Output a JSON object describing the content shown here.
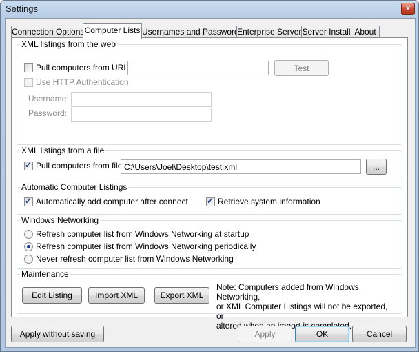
{
  "window": {
    "title": "Settings",
    "close_glyph": "x"
  },
  "tabs": [
    {
      "label": "Connection Options",
      "active": false
    },
    {
      "label": "Computer Lists",
      "active": true
    },
    {
      "label": "Usernames and Passwords",
      "active": false
    },
    {
      "label": "Enterprise Server",
      "active": false
    },
    {
      "label": "Server Install",
      "active": false
    },
    {
      "label": "About",
      "active": false
    }
  ],
  "web_group": {
    "title": "XML listings from the web",
    "pull_url_label": "Pull computers from URL:",
    "pull_url_checked": false,
    "url_value": "",
    "test_button": "Test",
    "http_auth_label": "Use HTTP Authentication",
    "http_auth_checked": false,
    "username_label": "Username:",
    "username_value": "",
    "password_label": "Password:",
    "password_value": ""
  },
  "file_group": {
    "title": "XML listings from a file",
    "pull_file_label": "Pull computers from file:",
    "pull_file_checked": true,
    "file_path": "C:\\Users\\Joel\\Desktop\\test.xml",
    "browse_button": "..."
  },
  "auto_group": {
    "title": "Automatic Computer Listings",
    "auto_add_label": "Automatically add computer after connect",
    "auto_add_checked": true,
    "retrieve_label": "Retrieve system information",
    "retrieve_checked": true
  },
  "networking_group": {
    "title": "Windows Networking",
    "options": [
      {
        "label": "Refresh computer list from Windows Networking at startup",
        "selected": false
      },
      {
        "label": "Refresh computer list from Windows Networking periodically",
        "selected": true
      },
      {
        "label": "Never refresh computer list from Windows Networking",
        "selected": false
      }
    ]
  },
  "maintenance_group": {
    "title": "Maintenance",
    "edit_button": "Edit Listing",
    "import_button": "Import XML",
    "export_button": "Export XML",
    "note_lines": [
      "Note: Computers added from Windows Networking,",
      "or XML Computer Listings will not be exported, or",
      "altered when an import is completed."
    ]
  },
  "footer": {
    "apply_without_saving": "Apply without saving",
    "apply": "Apply",
    "ok": "OK",
    "cancel": "Cancel"
  }
}
